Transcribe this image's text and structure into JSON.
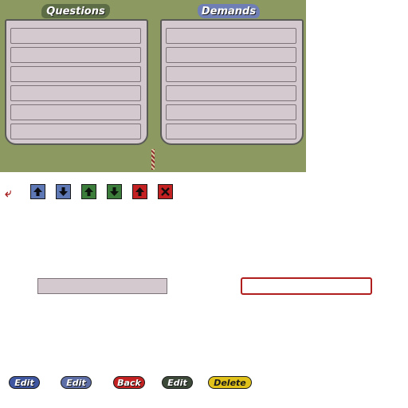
{
  "boards": {
    "questions": {
      "title": "Questions",
      "slots": [
        "",
        "",
        "",
        "",
        "",
        ""
      ]
    },
    "demands": {
      "title": "Demands",
      "slots": [
        "",
        "",
        "",
        "",
        "",
        ""
      ]
    }
  },
  "toolbar": {
    "buttons": [
      {
        "name": "move-up-blue",
        "icon": "arrow-up-icon",
        "color": "#5d78b4"
      },
      {
        "name": "move-down-blue",
        "icon": "arrow-down-icon",
        "color": "#5d78b4"
      },
      {
        "name": "move-up-green",
        "icon": "arrow-up-icon",
        "color": "#3c7d3c"
      },
      {
        "name": "move-down-green",
        "icon": "arrow-down-icon",
        "color": "#3c7d3c"
      },
      {
        "name": "move-up-red",
        "icon": "arrow-up-icon",
        "color": "#c42222"
      },
      {
        "name": "close-red",
        "icon": "close-icon",
        "color": "#c42222"
      }
    ]
  },
  "buttons": {
    "edit1": "Edit",
    "edit2": "Edit",
    "back": "Back",
    "edit3": "Edit",
    "delete": "Delete"
  }
}
